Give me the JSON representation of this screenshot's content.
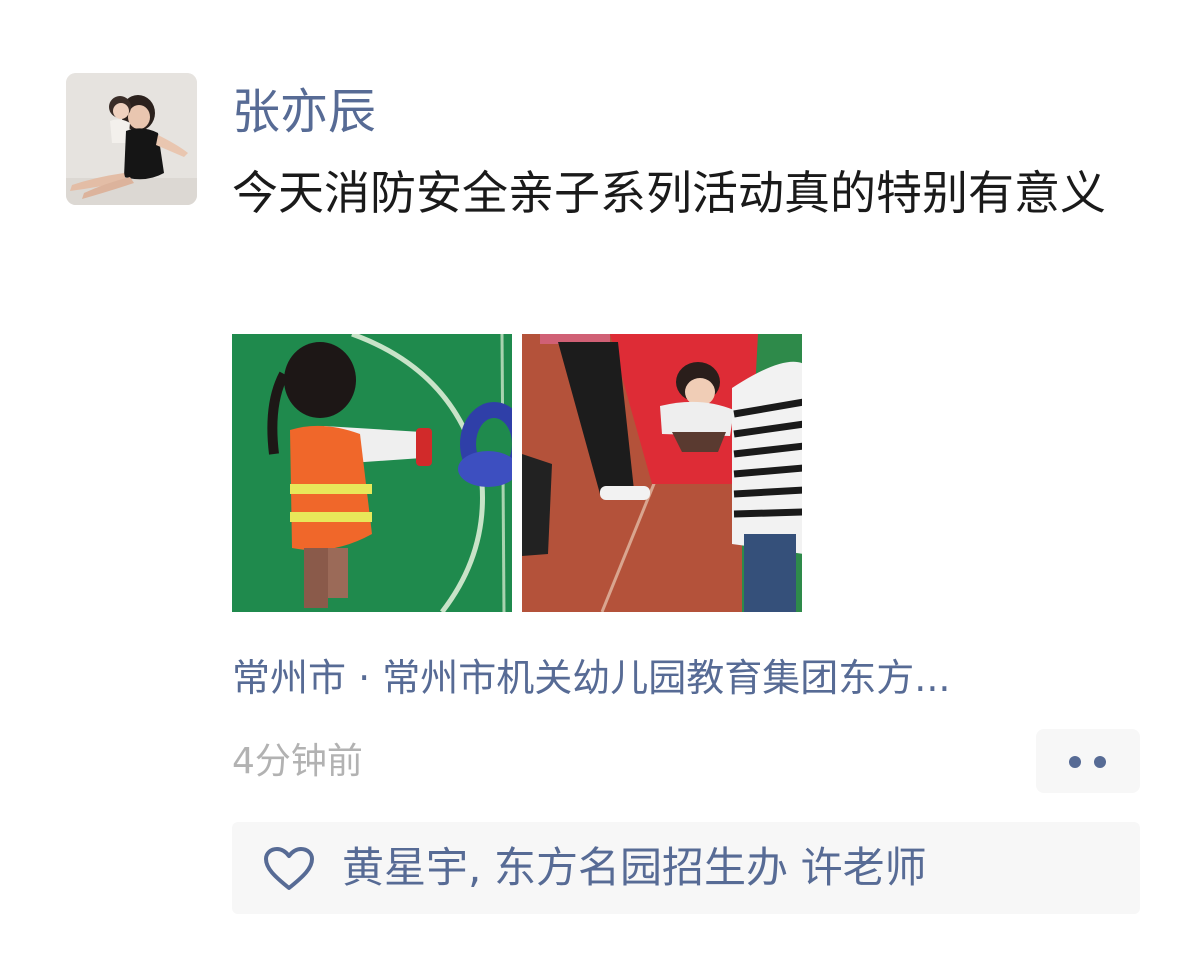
{
  "post": {
    "author": "张亦辰",
    "text": "今天消防安全亲子系列活动真的特别有意义",
    "location": "常州市 · 常州市机关幼儿园教育集团东方...",
    "time": "4分钟前"
  },
  "likes": {
    "names": [
      "黄星宇,",
      "东方名园招生办",
      "许老师"
    ]
  },
  "colors": {
    "link": "#576b95",
    "text": "#1a1a1a",
    "muted": "#b2b2b2",
    "panel": "#f7f7f7"
  },
  "icons": {
    "like": "heart-outline-icon",
    "more": "more-dots-icon"
  }
}
